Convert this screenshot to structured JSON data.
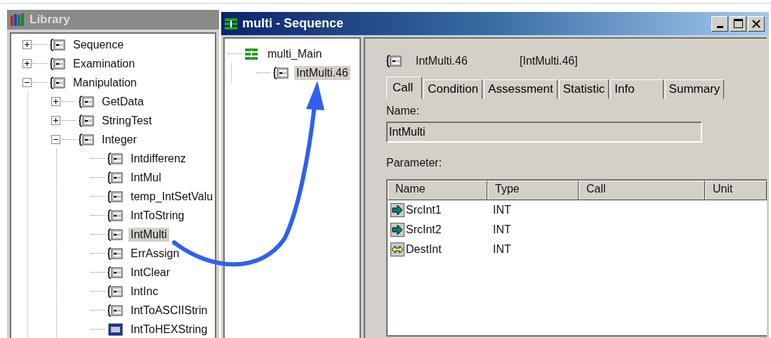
{
  "library": {
    "title": "Library",
    "tree": [
      {
        "label": "Sequence",
        "kind": "brace",
        "expanded": false,
        "selected": false
      },
      {
        "label": "Examination",
        "kind": "brace",
        "expanded": false,
        "selected": false
      },
      {
        "label": "Manipulation",
        "kind": "brace",
        "expanded": true,
        "selected": false,
        "children": [
          {
            "label": "GetData",
            "kind": "brace",
            "expanded": false,
            "selected": false
          },
          {
            "label": "StringTest",
            "kind": "brace",
            "expanded": false,
            "selected": false
          },
          {
            "label": "Integer",
            "kind": "brace",
            "expanded": true,
            "selected": false,
            "children": [
              {
                "label": "Intdifferenz",
                "kind": "brace",
                "selected": false
              },
              {
                "label": "IntMul",
                "kind": "brace",
                "selected": false
              },
              {
                "label": "temp_IntSetValu",
                "kind": "brace",
                "selected": false
              },
              {
                "label": "IntToString",
                "kind": "brace",
                "selected": false
              },
              {
                "label": "IntMulti",
                "kind": "brace",
                "selected": true
              },
              {
                "label": "ErrAssign",
                "kind": "brace",
                "selected": false
              },
              {
                "label": "IntClear",
                "kind": "brace",
                "selected": false
              },
              {
                "label": "IntInc",
                "kind": "brace",
                "selected": false
              },
              {
                "label": "IntToASCIIStrin",
                "kind": "brace",
                "selected": false
              },
              {
                "label": "IntToHEXString",
                "kind": "box",
                "selected": false
              }
            ]
          }
        ]
      }
    ]
  },
  "window": {
    "title": "multi - Sequence",
    "sequence_tree": [
      {
        "label": "multi_Main",
        "kind": "sequence",
        "selected": false,
        "children": [
          {
            "label": "IntMulti.46",
            "kind": "brace",
            "selected": true
          }
        ]
      }
    ],
    "header": {
      "name": "IntMulti.46",
      "reference": "[IntMulti.46]"
    },
    "tabs": [
      {
        "label": "Call",
        "selected": true
      },
      {
        "label": "Condition",
        "selected": false
      },
      {
        "label": "Assessment",
        "selected": false
      },
      {
        "label": "Statistic",
        "selected": false
      },
      {
        "label": "Info",
        "selected": false
      },
      {
        "label": "Summary",
        "selected": false
      }
    ],
    "name_label": "Name:",
    "name_value": "IntMulti",
    "parameter_label": "Parameter:",
    "table": {
      "columns": [
        "Name",
        "Type",
        "Call",
        "Unit"
      ],
      "rows": [
        {
          "kind": "input",
          "name": "SrcInt1",
          "type": "INT"
        },
        {
          "kind": "input",
          "name": "SrcInt2",
          "type": "INT"
        },
        {
          "kind": "inout",
          "name": "DestInt",
          "type": "INT"
        }
      ]
    }
  }
}
